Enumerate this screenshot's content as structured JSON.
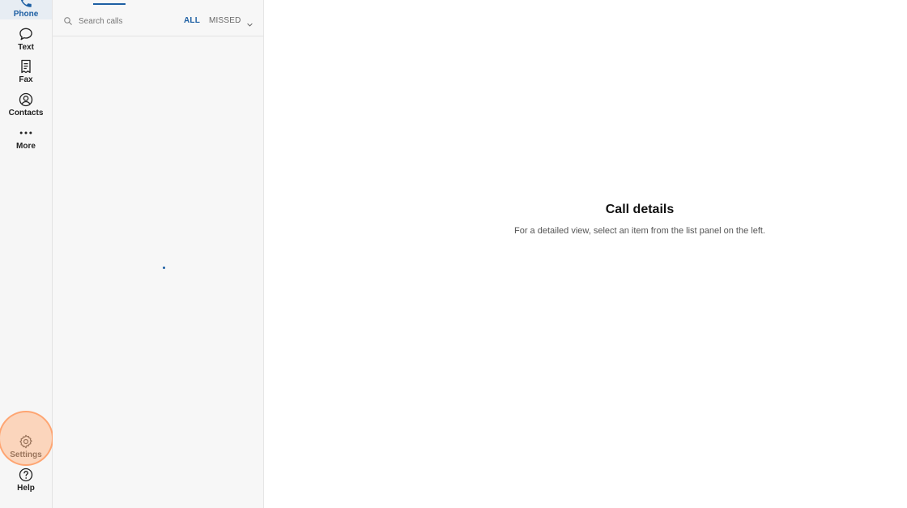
{
  "nav": {
    "items": [
      {
        "label": "Phone",
        "icon": "phone-icon",
        "active": true
      },
      {
        "label": "Text",
        "icon": "chat-bubble-icon"
      },
      {
        "label": "Fax",
        "icon": "fax-document-icon"
      },
      {
        "label": "Contacts",
        "icon": "contact-person-icon"
      },
      {
        "label": "More",
        "icon": "more-dots-icon"
      }
    ],
    "bottom_items": [
      {
        "label": "Settings",
        "icon": "gear-icon",
        "highlighted": true
      },
      {
        "label": "Help",
        "icon": "help-circle-icon"
      }
    ]
  },
  "list_panel": {
    "search": {
      "placeholder": "Search calls",
      "value": ""
    },
    "filters": {
      "all_label": "ALL",
      "missed_label": "MISSED",
      "selected": "ALL"
    }
  },
  "detail": {
    "title": "Call details",
    "subtitle": "For a detailed view, select an item from the list panel on the left."
  },
  "colors": {
    "accent": "#1d5fa3",
    "rail_background": "#f6f6f6",
    "active_nav_background": "#e7edf3",
    "highlight_ring": "#ff965a"
  }
}
